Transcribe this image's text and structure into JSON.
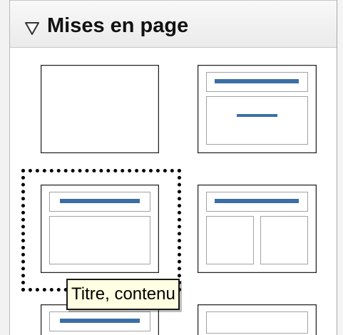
{
  "panel": {
    "title": "Mises en page",
    "collapse_icon": "triangle-down-icon"
  },
  "colors": {
    "title_bar_blue": "#3c6ea6",
    "tooltip_bg": "#ffffe1"
  },
  "layouts": [
    {
      "id": "blank"
    },
    {
      "id": "title-only"
    },
    {
      "id": "title-content",
      "selected": true
    },
    {
      "id": "title-two-columns"
    },
    {
      "id": "row3-left"
    },
    {
      "id": "row3-right"
    }
  ],
  "tooltip": {
    "text": "Titre, contenu"
  }
}
